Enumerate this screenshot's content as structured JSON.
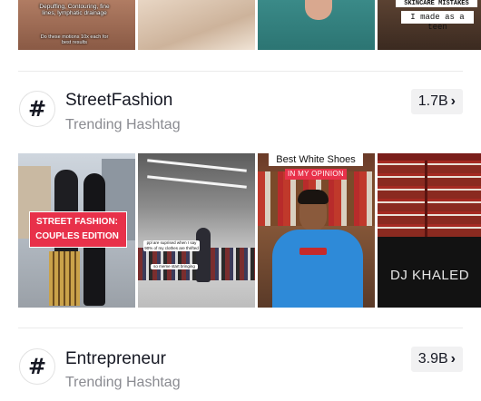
{
  "top_row": {
    "thumb1_caption_main": "Depuffing, Contouring, fine lines, lymphatic drainage",
    "thumb1_caption_sub": "Do these motions 10x each for best results",
    "thumb4_caption_a": "SKINCARE MISTAKES",
    "thumb4_caption_b": "I made as a teen"
  },
  "hashtags": [
    {
      "icon": "hashtag-icon",
      "name": "StreetFashion",
      "subtitle": "Trending Hashtag",
      "count": "1.7B",
      "videos": [
        {
          "caption_a": "STREET FASHION:",
          "caption_b": "COUPLES EDITION"
        },
        {
          "caption_a": "ppl are suprised when I say 90% of my clothes are thrifted",
          "caption_b": "so meme start bringing"
        },
        {
          "caption_a": "Best White Shoes",
          "caption_b": "IN MY OPINION"
        },
        {
          "caption_a": "DJ KHALED",
          "caption_b": ""
        }
      ]
    },
    {
      "icon": "hashtag-icon",
      "name": "Entrepreneur",
      "subtitle": "Trending Hashtag",
      "count": "3.9B"
    }
  ],
  "colors": {
    "text": "#161823",
    "secondary_text": "#8a8b91",
    "count_bg": "#f1f1f2",
    "accent_red": "#e8314a"
  }
}
